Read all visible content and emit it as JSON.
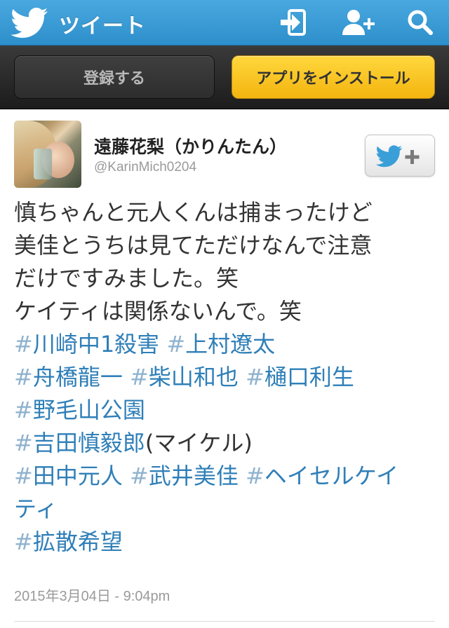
{
  "header": {
    "title": "ツイート",
    "brand_color": "#2d8fcb",
    "icons": [
      "twitter-bird-icon",
      "sign-in-icon",
      "follow-user-icon",
      "search-icon"
    ]
  },
  "toolbar": {
    "register_label": "登録する",
    "install_label": "アプリをインストール"
  },
  "tweet": {
    "user_name": "遠藤花梨（かりんたん）",
    "handle": "@KarinMich0204",
    "lines": [
      [
        {
          "text": "慎ちゃんと元人くんは捕まったけど"
        }
      ],
      [
        {
          "text": "美佳とうちは見てただけなんで注意"
        }
      ],
      [
        {
          "text": "だけですみました。笑"
        }
      ],
      [
        {
          "text": "ケイティは関係ないんで。笑"
        }
      ],
      [
        {
          "hash": "#",
          "tag": "川崎中1殺害"
        },
        {
          "text": " "
        },
        {
          "hash": "#",
          "tag": "上村遼太"
        }
      ],
      [
        {
          "hash": "#",
          "tag": "舟橋龍一"
        },
        {
          "text": " "
        },
        {
          "hash": "#",
          "tag": "柴山和也"
        },
        {
          "text": " "
        },
        {
          "hash": "#",
          "tag": "樋口利生"
        }
      ],
      [
        {
          "hash": "#",
          "tag": "野毛山公園"
        }
      ],
      [
        {
          "hash": "#",
          "tag": "吉田慎毅郎"
        },
        {
          "text": "(マイケル)"
        }
      ],
      [
        {
          "hash": "#",
          "tag": "田中元人"
        },
        {
          "text": " "
        },
        {
          "hash": "#",
          "tag": "武井美佳"
        },
        {
          "text": " "
        },
        {
          "hash": "#",
          "tag": "ヘイセルケイ"
        }
      ],
      [
        {
          "tag": "ティ"
        }
      ],
      [
        {
          "hash": "#",
          "tag": "拡散希望"
        }
      ]
    ],
    "timestamp": "2015年3月04日 - 9:04pm",
    "hashtag_color": "#2f7fb8"
  }
}
